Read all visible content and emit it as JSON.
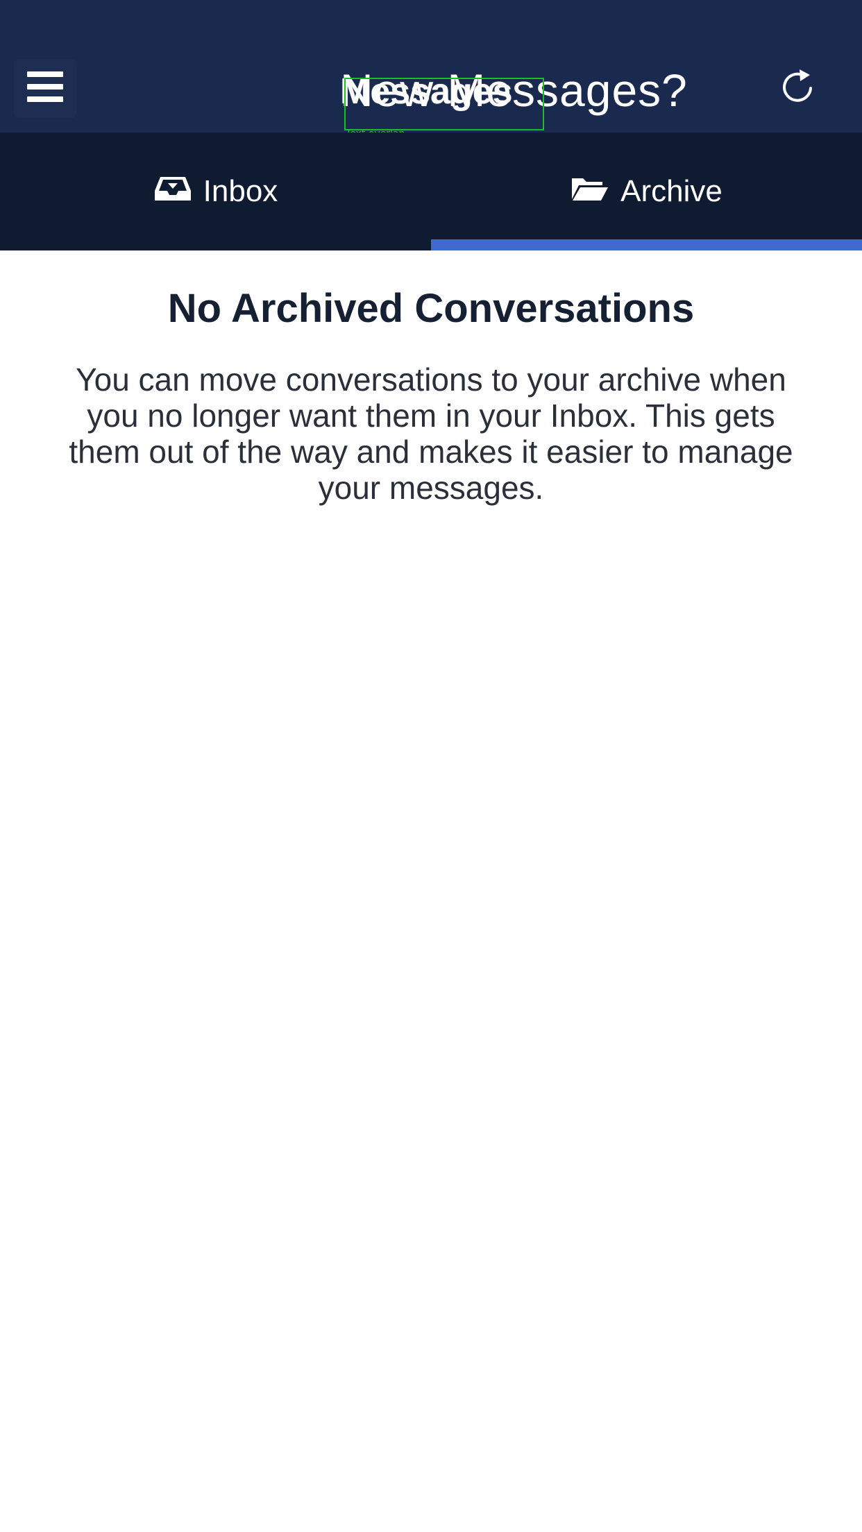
{
  "header": {
    "title_back": "New Messages?",
    "title_front": "Messages",
    "menu_icon": "hamburger-menu-icon",
    "refresh_icon": "refresh-icon",
    "overlay_label": "Text overlap"
  },
  "tabs": [
    {
      "label": "Inbox",
      "icon": "inbox-tray-icon",
      "active": false
    },
    {
      "label": "Archive",
      "icon": "folder-open-icon",
      "active": true
    }
  ],
  "empty_state": {
    "title": "No Archived Conversations",
    "message": "You can move conversations to your archive when you no longer want them in your Inbox. This gets them out of the way and makes it easier to manage your messages."
  },
  "colors": {
    "header_bg": "#1a2a4f",
    "tabs_bg": "#0f1b31",
    "active_tab_underline": "#3f6bd0",
    "title_text": "#162033"
  }
}
